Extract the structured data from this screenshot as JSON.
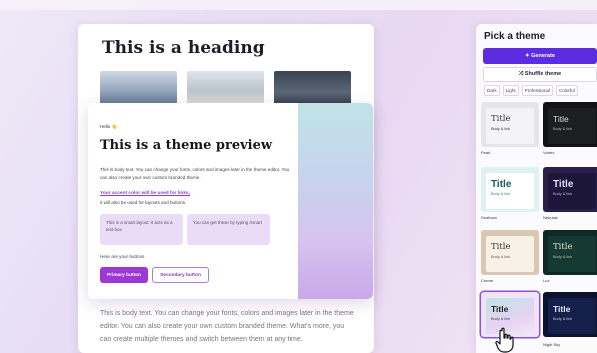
{
  "preview": {
    "heading": "This is a heading",
    "hello": "Hello 👋",
    "title": "This is a theme preview",
    "body_text": "This is body text. You can change your fonts, colors and images later in the theme editor. You can also create your own custom branded theme.",
    "accent_link": "Your accent color will be used for links,",
    "accent_note": "it will also be used for layouts and buttons.",
    "box1": "This is a smart layout: it acts as a text box.",
    "box2": "You can get these by typing /smart",
    "buttons_note": "Here are your buttons",
    "primary_button": "Primary button",
    "secondary_button": "Secondary button",
    "back_body": "This is body text. You can change your fonts, colors and images later in the theme editor. You can also create your own custom branded theme. What's more, you can create multiple themes and switch between them at any time."
  },
  "panel": {
    "title": "Pick a theme",
    "generate": "✦ Generate",
    "shuffle": "⤮ Shuffle theme",
    "tabs": [
      "Dark",
      "Light",
      "Professional",
      "Colorful"
    ],
    "tile_title": "Title",
    "tile_sub": "Body & link",
    "themes": [
      "Pearl",
      "Vortex",
      "Seafoam",
      "Nebulae",
      "Creme",
      "Lux",
      "",
      "Night Sky"
    ]
  },
  "colors": {
    "accent": "#9c39d4",
    "generate_bg": "#5b2ce0"
  }
}
